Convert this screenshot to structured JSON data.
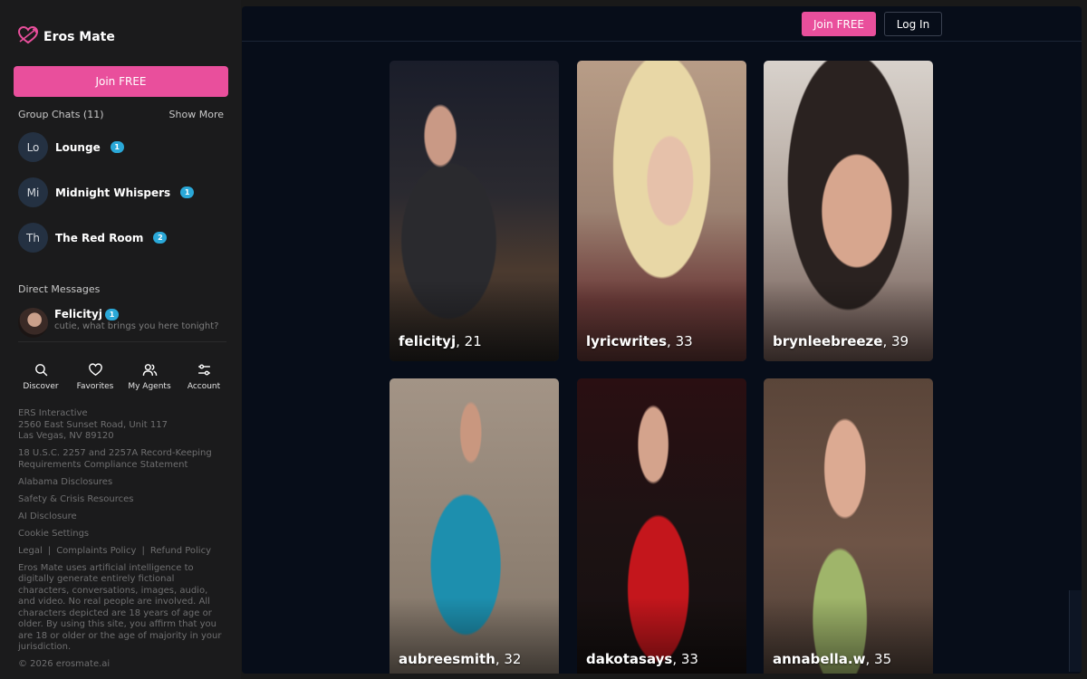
{
  "brand": {
    "name": "Eros Mate",
    "accent": "#e94f9c"
  },
  "sidebar": {
    "join_label": "Join FREE",
    "group_chats": {
      "header": "Group Chats (11)",
      "show_more": "Show More",
      "items": [
        {
          "initials": "Lo",
          "name": "Lounge",
          "unread": "1"
        },
        {
          "initials": "Mi",
          "name": "Midnight Whispers",
          "unread": "1"
        },
        {
          "initials": "Th",
          "name": "The Red Room",
          "unread": "2"
        }
      ]
    },
    "direct_messages": {
      "header": "Direct Messages",
      "items": [
        {
          "name": "Felicityj",
          "unread": "1",
          "preview": "cutie, what brings you here tonight?"
        }
      ]
    },
    "tabs": [
      {
        "label": "Discover",
        "icon": "search-icon"
      },
      {
        "label": "Favorites",
        "icon": "heart-icon"
      },
      {
        "label": "My Agents",
        "icon": "users-icon"
      },
      {
        "label": "Account",
        "icon": "sliders-icon"
      }
    ],
    "footer": {
      "company": "ERS Interactive",
      "address_line1": "2560 East Sunset Road, Unit 117",
      "address_line2": "Las Vegas, NV 89120",
      "compliance": "18 U.S.C. 2257 and 2257A Record-Keeping Requirements Compliance Statement",
      "alabama": "Alabama Disclosures",
      "safety": "Safety & Crisis Resources",
      "ai": "AI Disclosure",
      "cookies": "Cookie Settings",
      "legal": "Legal",
      "complaints": "Complaints Policy",
      "refund": "Refund Policy",
      "separator": "|",
      "disclaimer": "Eros Mate uses artificial intelligence to digitally generate entirely fictional characters, conversations, images, audio, and video. No real people are involved. All characters depicted are 18 years of age or older. By using this site, you affirm that you are 18 or older or the age of majority in your jurisdiction.",
      "copyright": "© 2026 erosmate.ai"
    }
  },
  "header": {
    "join_label": "Join FREE",
    "login_label": "Log In"
  },
  "profiles": [
    {
      "username": "felicityj",
      "age": "21"
    },
    {
      "username": "lyricwrites",
      "age": "33"
    },
    {
      "username": "brynleebreeze",
      "age": "39"
    },
    {
      "username": "aubreesmith",
      "age": "32"
    },
    {
      "username": "dakotasays",
      "age": "33"
    },
    {
      "username": "annabella.w",
      "age": "35"
    }
  ]
}
